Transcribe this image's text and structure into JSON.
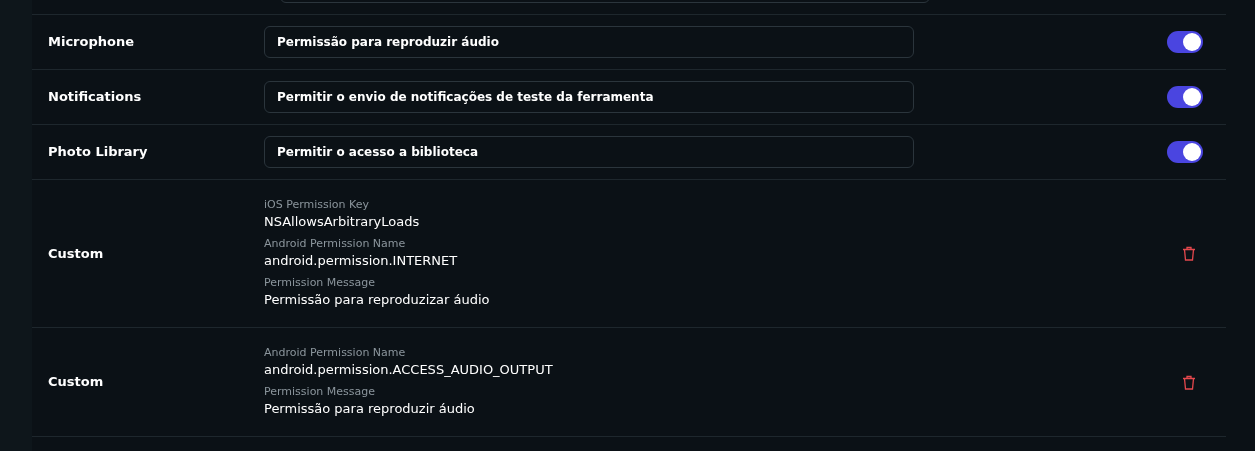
{
  "permissions": [
    {
      "kind": "toggle",
      "label": "Microphone",
      "value": "Permissão para reproduzir áudio",
      "on": true
    },
    {
      "kind": "toggle",
      "label": "Notifications",
      "value": "Permitir o envio de notificações de teste da ferramenta",
      "on": true
    },
    {
      "kind": "toggle",
      "label": "Photo Library",
      "value": "Permitir o acesso a biblioteca",
      "on": true
    },
    {
      "kind": "custom",
      "label": "Custom",
      "fields": [
        {
          "caption": "iOS Permission Key",
          "value": "NSAllowsArbitraryLoads"
        },
        {
          "caption": "Android Permission Name",
          "value": "android.permission.INTERNET"
        },
        {
          "caption": "Permission Message",
          "value": "Permissão para reproduzizar áudio"
        }
      ]
    },
    {
      "kind": "custom",
      "label": "Custom",
      "fields": [
        {
          "caption": "Android Permission Name",
          "value": "android.permission.ACCESS_AUDIO_OUTPUT"
        },
        {
          "caption": "Permission Message",
          "value": "Permissão para reproduzir áudio"
        }
      ]
    }
  ]
}
